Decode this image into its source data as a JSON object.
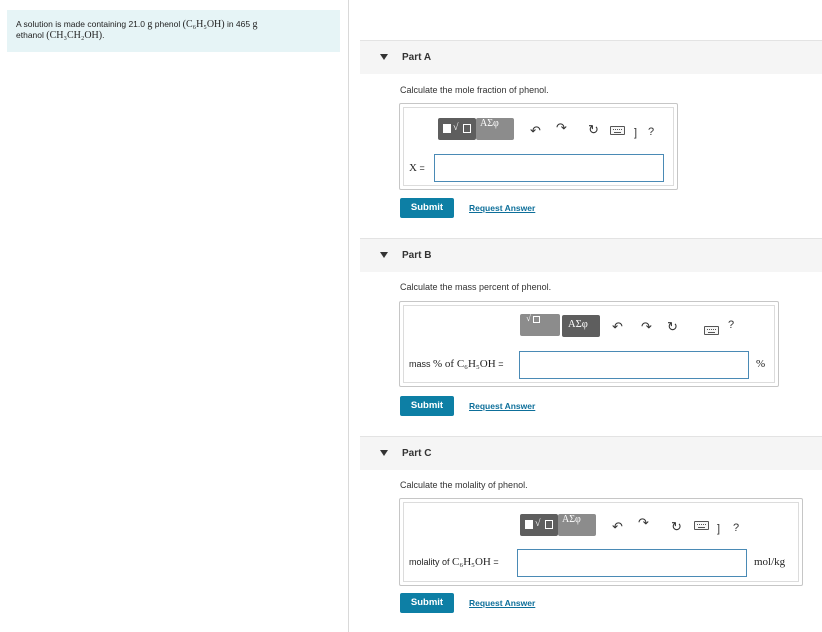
{
  "problem": {
    "text_before": "A solution is made containing 21.0 ",
    "unit_g": "g",
    "text_mid": " phenol ",
    "formula_phenol": "(C₆H₅OH)",
    "text_in": " in 465 ",
    "unit_g2": "g",
    "text_ethanol": "ethanol ",
    "formula_ethanol": "(CH₃CH₂OH)",
    "text_end": "."
  },
  "toolbar": {
    "templates_symbol": "▯√▯",
    "greek_symbol": "ΑΣφ",
    "help_label": "?",
    "bracket_label": "]"
  },
  "parts": [
    {
      "title": "Part A",
      "prompt": "Calculate the mole fraction of phenol.",
      "label_math": "X",
      "label_suffix": " =",
      "input_value": "",
      "unit": "",
      "submit_label": "Submit",
      "request_label": "Request Answer"
    },
    {
      "title": "Part B",
      "prompt": "Calculate the mass percent of phenol.",
      "label_text": "mass ",
      "label_math": "% of C₆H₅OH",
      "label_suffix": " =",
      "input_value": "",
      "unit": "%",
      "submit_label": "Submit",
      "request_label": "Request Answer"
    },
    {
      "title": "Part C",
      "prompt": "Calculate the molality of phenol.",
      "label_text": "molality of ",
      "label_math": "C₆H₅OH",
      "label_suffix": " =",
      "input_value": "",
      "unit": "mol/kg",
      "submit_label": "Submit",
      "request_label": "Request Answer"
    }
  ]
}
